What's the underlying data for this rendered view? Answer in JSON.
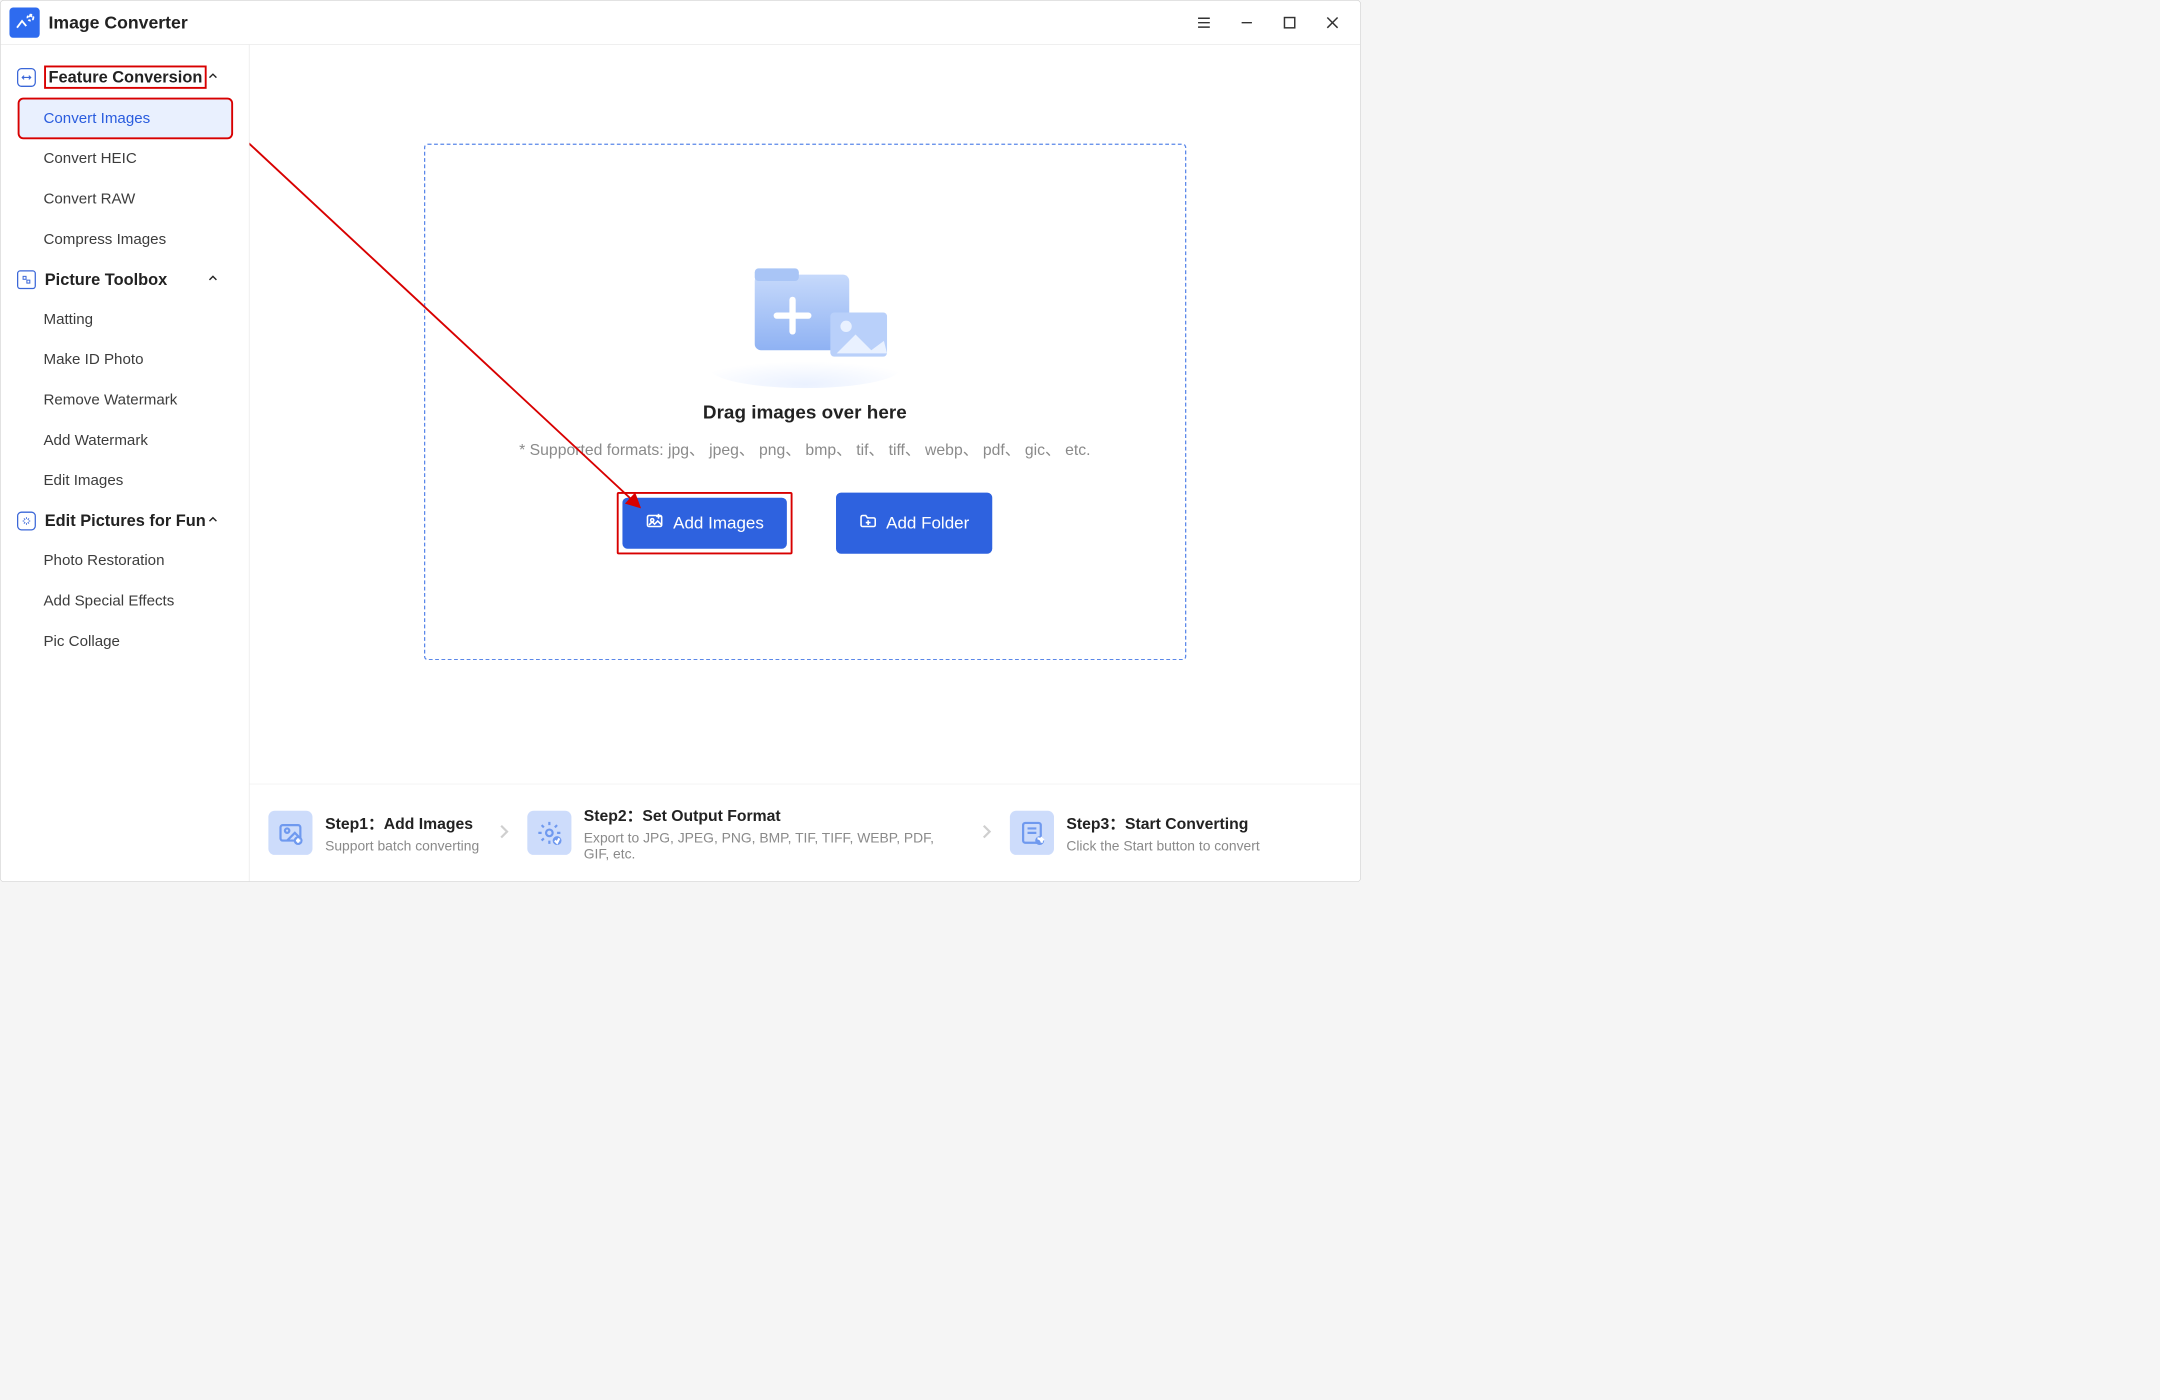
{
  "app": {
    "title": "Image Converter"
  },
  "sidebar": {
    "groups": [
      {
        "key": "feature",
        "title": "Feature Conversion",
        "items": [
          "Convert Images",
          "Convert HEIC",
          "Convert RAW",
          "Compress Images"
        ]
      },
      {
        "key": "toolbox",
        "title": "Picture Toolbox",
        "items": [
          "Matting",
          "Make ID Photo",
          "Remove Watermark",
          "Add Watermark",
          "Edit Images"
        ]
      },
      {
        "key": "fun",
        "title": "Edit Pictures for Fun",
        "items": [
          "Photo Restoration",
          "Add Special Effects",
          "Pic Collage"
        ]
      }
    ]
  },
  "main": {
    "drop_title": "Drag images over here",
    "drop_sub": "* Supported formats: jpg、 jpeg、 png、 bmp、 tif、 tiff、 webp、 pdf、 gic、 etc.",
    "add_images": "Add Images",
    "add_folder": "Add Folder"
  },
  "footer": {
    "step1_title": "Step1：Add Images",
    "step1_sub": "Support batch converting",
    "step2_title": "Step2：Set Output Format",
    "step2_sub": "Export to JPG, JPEG, PNG, BMP, TIF, TIFF, WEBP, PDF, GIF, etc.",
    "step3_title": "Step3：Start Converting",
    "step3_sub": "Click the Start button to convert"
  }
}
